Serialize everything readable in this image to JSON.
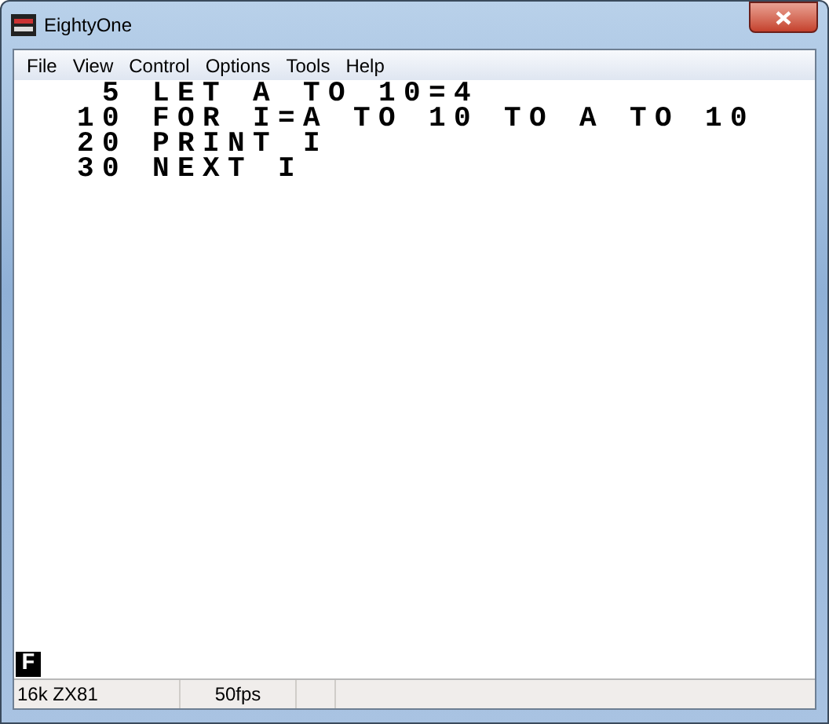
{
  "window": {
    "title": "EightyOne"
  },
  "menu": [
    "File",
    "View",
    "Control",
    "Options",
    "Tools",
    "Help"
  ],
  "screen": {
    "lines": [
      {
        "number": "5",
        "code": "LET A TO 10=4"
      },
      {
        "number": "10",
        "code": "FOR I=A TO 10 TO A TO 10"
      },
      {
        "number": "20",
        "code": "PRINT I"
      },
      {
        "number": "30",
        "code": "NEXT I"
      }
    ],
    "cursor": "F"
  },
  "status_bar": [
    "16k ZX81",
    "50fps"
  ]
}
